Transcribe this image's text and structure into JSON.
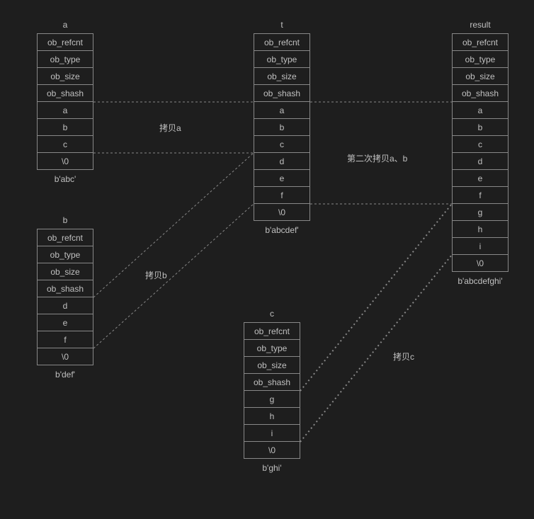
{
  "structs": {
    "a": {
      "title": "a",
      "caption": "b'abc'",
      "cells": [
        "ob_refcnt",
        "ob_type",
        "ob_size",
        "ob_shash",
        "a",
        "b",
        "c",
        "\\0"
      ]
    },
    "b": {
      "title": "b",
      "caption": "b'def'",
      "cells": [
        "ob_refcnt",
        "ob_type",
        "ob_size",
        "ob_shash",
        "d",
        "e",
        "f",
        "\\0"
      ]
    },
    "t": {
      "title": "t",
      "caption": "b'abcdef'",
      "cells": [
        "ob_refcnt",
        "ob_type",
        "ob_size",
        "ob_shash",
        "a",
        "b",
        "c",
        "d",
        "e",
        "f",
        "\\0"
      ]
    },
    "c": {
      "title": "c",
      "caption": "b'ghi'",
      "cells": [
        "ob_refcnt",
        "ob_type",
        "ob_size",
        "ob_shash",
        "g",
        "h",
        "i",
        "\\0"
      ]
    },
    "result": {
      "title": "result",
      "caption": "b'abcdefghi'",
      "cells": [
        "ob_refcnt",
        "ob_type",
        "ob_size",
        "ob_shash",
        "a",
        "b",
        "c",
        "d",
        "e",
        "f",
        "g",
        "h",
        "i",
        "\\0"
      ]
    }
  },
  "labels": {
    "copy_a": "拷贝a",
    "copy_b": "拷贝b",
    "copy_c": "拷贝c",
    "copy_ab": "第二次拷贝a、b"
  }
}
